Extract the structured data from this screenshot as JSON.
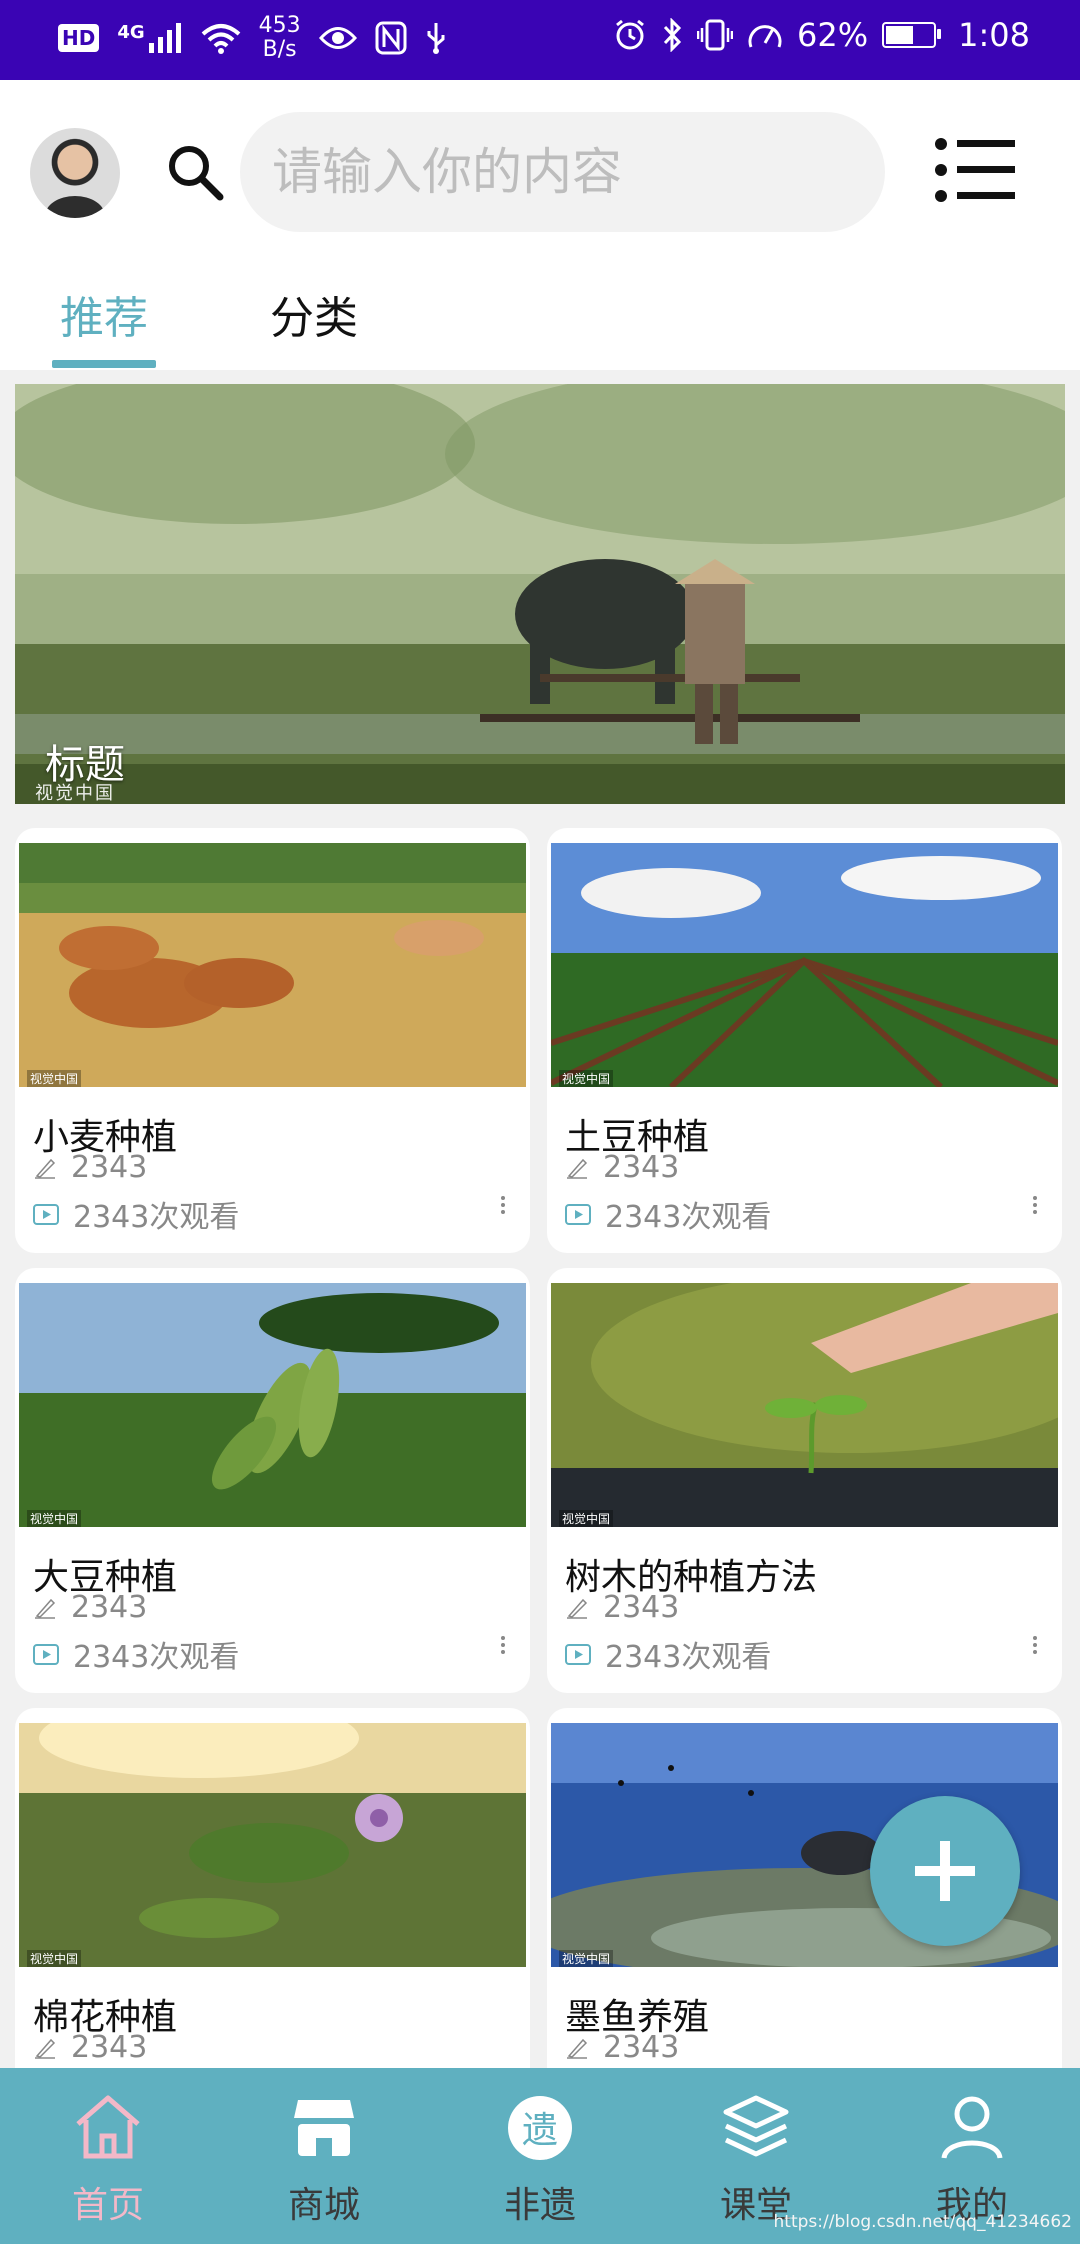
{
  "status_bar": {
    "left_badge": "HD",
    "network": "4G",
    "net_speed_value": "453",
    "net_speed_unit": "B/s",
    "battery_text": "62%",
    "battery_level": 0.62,
    "time": "1:08"
  },
  "header": {
    "search_placeholder": "请输入你的内容"
  },
  "tabs": [
    {
      "label": "推荐",
      "active": true
    },
    {
      "label": "分类",
      "active": false
    }
  ],
  "banner": {
    "title": "标题",
    "watermark": "视觉中国"
  },
  "cards": [
    {
      "title": "小麦种植",
      "author_count": "2343",
      "views": "2343次观看",
      "watermark": "视觉中国"
    },
    {
      "title": "土豆种植",
      "author_count": "2343",
      "views": "2343次观看",
      "watermark": "视觉中国"
    },
    {
      "title": "大豆种植",
      "author_count": "2343",
      "views": "2343次观看",
      "watermark": "视觉中国"
    },
    {
      "title": "树木的种植方法",
      "author_count": "2343",
      "views": "2343次观看",
      "watermark": "视觉中国"
    },
    {
      "title": "棉花种植",
      "author_count": "2343",
      "views": "",
      "watermark": "视觉中国"
    },
    {
      "title": "墨鱼养殖",
      "author_count": "2343",
      "views": "",
      "watermark": "视觉中国"
    }
  ],
  "bottom_nav": [
    {
      "label": "首页",
      "icon": "home-icon",
      "active": true
    },
    {
      "label": "商城",
      "icon": "store-icon",
      "active": false
    },
    {
      "label": "非遗",
      "icon": "heritage-icon",
      "icon_text": "遗",
      "active": false
    },
    {
      "label": "课堂",
      "icon": "layers-icon",
      "active": false
    },
    {
      "label": "我的",
      "icon": "user-icon",
      "active": false
    }
  ],
  "footer": {
    "url": "https://blog.csdn.net/qq_41234662"
  },
  "colors": {
    "status_bar": "#3a04b4",
    "accent": "#5fb0c0",
    "nav_active": "#f3b8c8"
  }
}
